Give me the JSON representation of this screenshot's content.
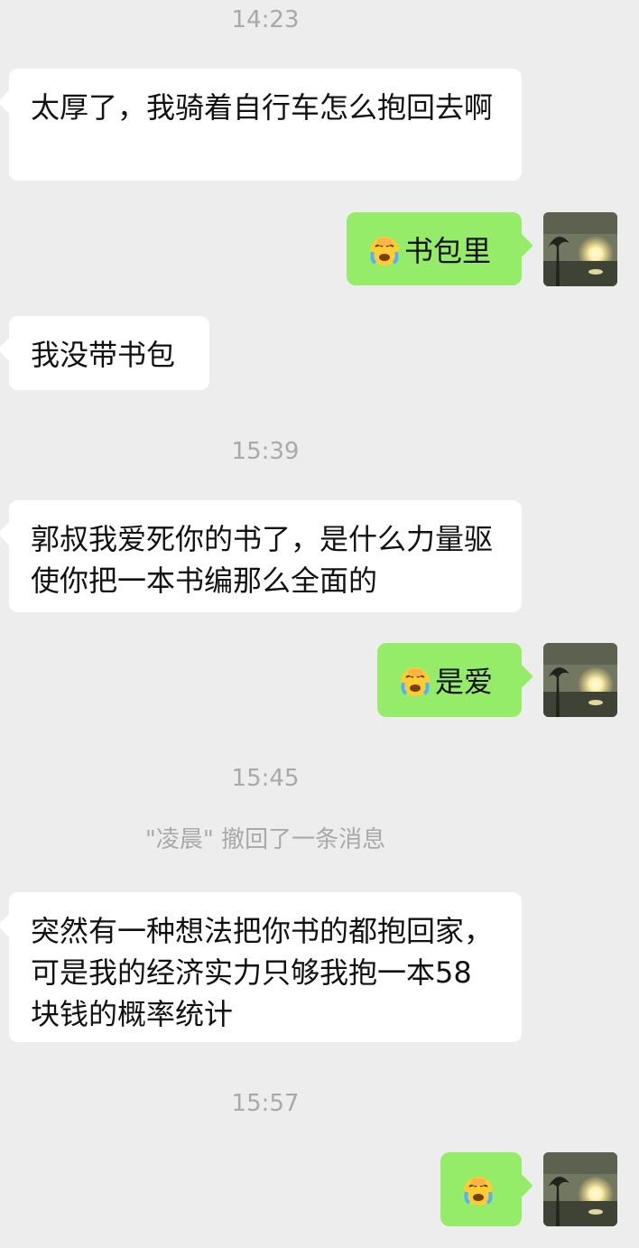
{
  "timestamps": {
    "t1": "14:23",
    "t2": "15:39",
    "t3": "15:45",
    "t4": "15:57"
  },
  "messages": {
    "m1": "太厚了，我骑着自行车怎么抱回去啊",
    "m2": "书包里",
    "m3": "我没带书包",
    "m4": "郭叔我爱死你的书了，是什么力量驱使你把一本书编那么全面的",
    "m5": "是爱",
    "m7": "突然有一种想法把你书的都抱回家，可是我的经济实力只够我抱一本58块钱的概率统计"
  },
  "system": {
    "recall_notice": "\"凌晨\" 撤回了一条消息"
  },
  "icons": {
    "emoji": "face-palm-crying-emoji",
    "avatar": "sunset-lake-avatar"
  },
  "colors": {
    "chat_background": "#ededed",
    "incoming_bubble": "#ffffff",
    "outgoing_bubble": "#95ec69",
    "timestamp_text": "#a9a9a9"
  }
}
